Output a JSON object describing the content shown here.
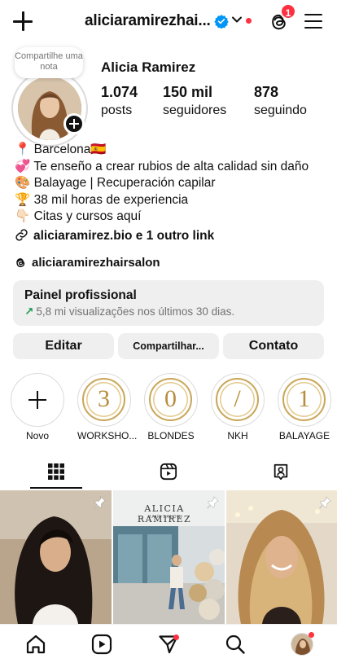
{
  "header": {
    "username": "aliciaramirezhai...",
    "notification_count": "1"
  },
  "profile": {
    "note": "Compartilhe uma nota",
    "display_name": "Alicia Ramirez",
    "stats": [
      {
        "value": "1.074",
        "label": "posts"
      },
      {
        "value": "150 mil",
        "label": "seguidores"
      },
      {
        "value": "878",
        "label": "seguindo"
      }
    ]
  },
  "bio": {
    "lines": [
      "📍 Barcelona🇪🇸",
      "💞 Te enseño a crear rubios de alta calidad sin daño",
      "🎨 Balayage | Recuperación capilar",
      "🏆 38 mil horas de experiencia",
      "👇🏻 Citas y cursos aquí"
    ],
    "link": "aliciaramirez.bio e 1 outro link",
    "threads": "aliciaramirezhairsalon"
  },
  "professional_panel": {
    "title": "Painel profissional",
    "subtitle": "5,8 mi visualizações nos últimos 30 dias."
  },
  "actions": {
    "edit": "Editar",
    "share": "Compartilhar...",
    "contact": "Contato"
  },
  "highlights": [
    {
      "label": "Novo",
      "glyph": ""
    },
    {
      "label": "WORKSHO...",
      "glyph": "3"
    },
    {
      "label": "BLONDES",
      "glyph": "0"
    },
    {
      "label": "NKH",
      "glyph": "/"
    },
    {
      "label": "BALAYAGE",
      "glyph": "1"
    }
  ],
  "tabs": [
    "grid-icon",
    "reels-icon",
    "tagged-icon"
  ],
  "colors": {
    "notification_red": "#ff3040",
    "verified_blue": "#0095f6",
    "growth_green": "#1f9b54",
    "highlight_gold": "#c9a65a"
  },
  "grid_posts": [
    {
      "sign_text": ""
    },
    {
      "sign_text": "ALICIA RAMIREZ",
      "sign_sub": "HAIR SALON"
    },
    {
      "sign_text": ""
    }
  ]
}
